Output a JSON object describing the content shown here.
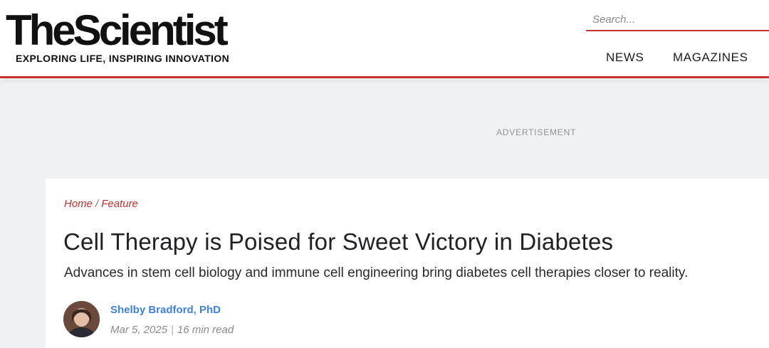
{
  "header": {
    "logo": {
      "wordmark": "TheScientist",
      "tagline": "EXPLORING LIFE, INSPIRING INNOVATION"
    },
    "search": {
      "placeholder": "Search...",
      "value": ""
    },
    "nav": [
      {
        "label": "NEWS"
      },
      {
        "label": "MAGAZINES"
      }
    ]
  },
  "ad": {
    "label": "ADVERTISEMENT"
  },
  "article": {
    "breadcrumb": {
      "home": "Home",
      "separator": "/",
      "section": "Feature"
    },
    "title": "Cell Therapy is Poised for Sweet Victory in Diabetes",
    "subtitle": "Advances in stem cell biology and immune cell engineering bring diabetes cell therapies closer to reality.",
    "author": {
      "name": "Shelby Bradford, PhD"
    },
    "date": "Mar 5, 2025",
    "meta_separator": "|",
    "read_time": "16 min read"
  },
  "colors": {
    "accent": "#c8312d",
    "author_link": "#3f82d6",
    "ad_background": "#eff1f3"
  }
}
